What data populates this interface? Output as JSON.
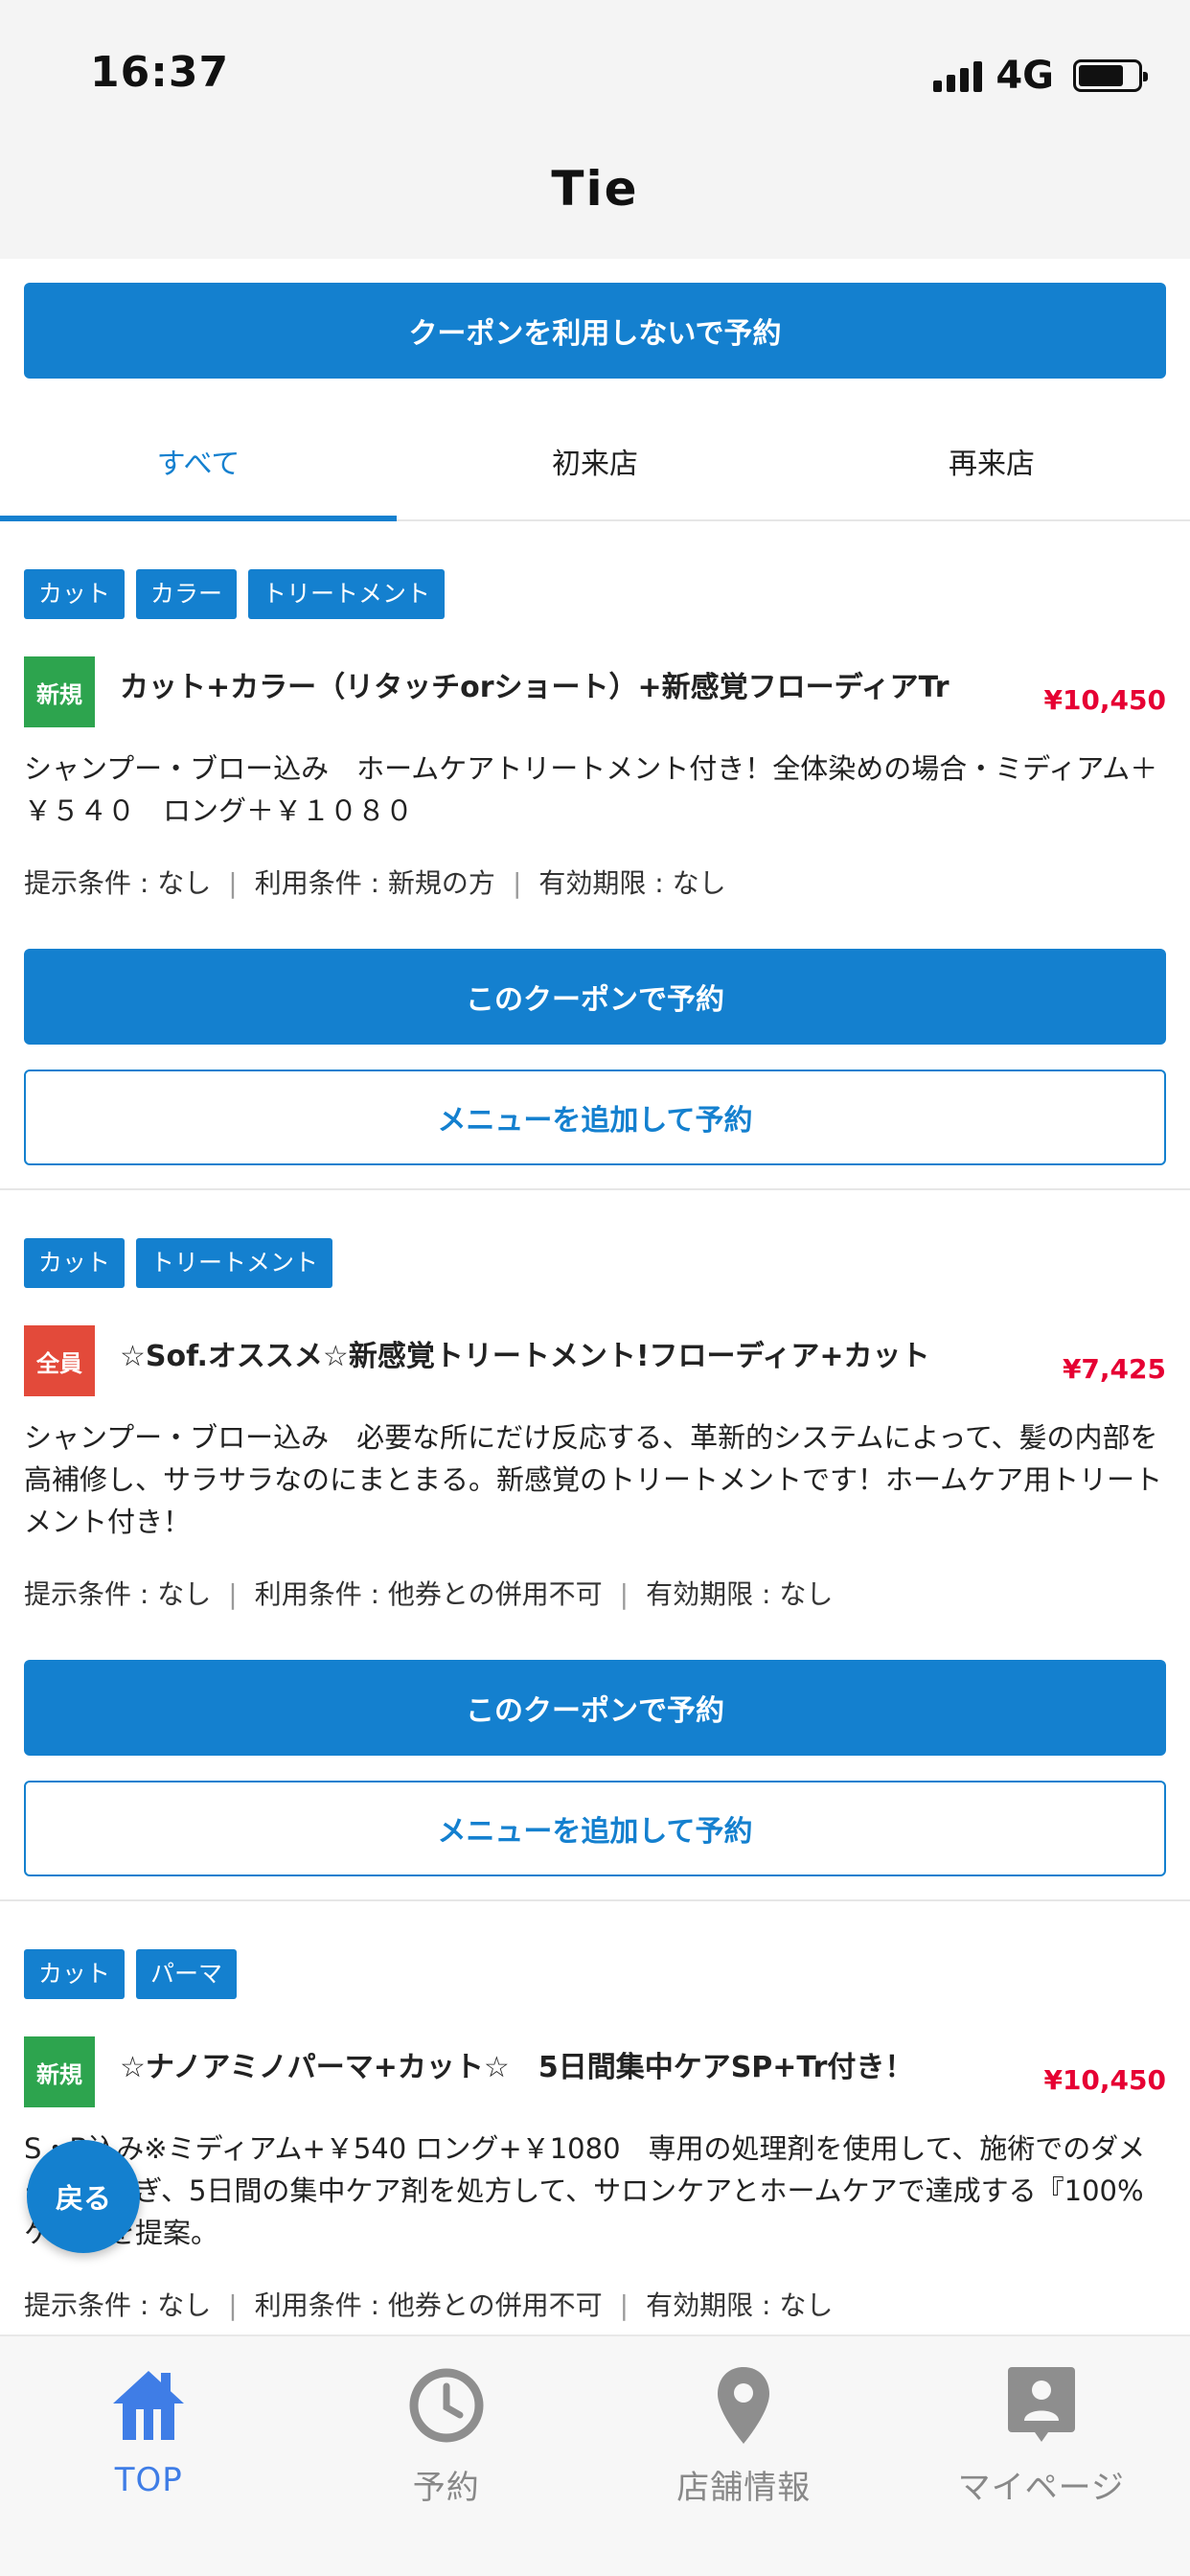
{
  "status_bar": {
    "time": "16:37",
    "network": "4G"
  },
  "header": {
    "title": "Tie"
  },
  "no_coupon_button": "クーポンを利用しないで予約",
  "tabs": [
    {
      "label": "すべて",
      "active": true
    },
    {
      "label": "初来店",
      "active": false
    },
    {
      "label": "再来店",
      "active": false
    }
  ],
  "coupons": [
    {
      "tags": [
        "カット",
        "カラー",
        "トリートメント"
      ],
      "badge": "新規",
      "title": "カット+カラー（リタッチorショート）+新感覚フローディアTr",
      "price": "¥10,450",
      "description": "シャンプー・ブロー込み　ホームケアトリートメント付き！全体染めの場合・ミディアム＋￥５４０　ロング＋￥１０８０",
      "conditions": {
        "display": "提示条件 : なし",
        "usage": "利用条件 : 新規の方",
        "expiry": "有効期限 : なし"
      },
      "reserve_label": "このクーポンで予約",
      "add_menu_label": "メニューを追加して予約"
    },
    {
      "tags": [
        "カット",
        "トリートメント"
      ],
      "badge": "全員",
      "title": "☆Sof.オススメ☆新感覚トリートメント!フローディア+カット",
      "price": "¥7,425",
      "description": "シャンプー・ブロー込み　必要な所にだけ反応する、革新的システムによって、髪の内部を高補修し、サラサラなのにまとまる。新感覚のトリートメントです！ホームケア用トリートメント付き！",
      "conditions": {
        "display": "提示条件 : なし",
        "usage": "利用条件 : 他券との併用不可",
        "expiry": "有効期限 : なし"
      },
      "reserve_label": "このクーポンで予約",
      "add_menu_label": "メニューを追加して予約"
    },
    {
      "tags": [
        "カット",
        "パーマ"
      ],
      "badge": "新規",
      "title": "☆ナノアミノパーマ+カット☆　5日間集中ケアSP+Tr付き！",
      "price": "¥10,450",
      "description": "S・B込み※ミディアム+￥540 ロング+￥1080　専用の処理剤を使用して、施術でのダメージを防ぎ、5日間の集中ケア剤を処方して、サロンケアとホームケアで達成する『100%ケア』を提案。",
      "conditions": {
        "display": "提示条件 : なし",
        "usage": "利用条件 : 他券との併用不可",
        "expiry": "有効期限 : なし"
      }
    }
  ],
  "back_button": "戻る",
  "bottom_nav": [
    {
      "label": "TOP",
      "icon": "home-icon",
      "active": true
    },
    {
      "label": "予約",
      "icon": "clock-icon",
      "active": false
    },
    {
      "label": "店舗情報",
      "icon": "location-pin-icon",
      "active": false
    },
    {
      "label": "マイページ",
      "icon": "user-card-icon",
      "active": false
    }
  ],
  "colors": {
    "primary": "#1480cf",
    "price": "#e60033",
    "badge_new": "#2da44e",
    "badge_all": "#e34a3a",
    "nav_active": "#3f7de6"
  }
}
